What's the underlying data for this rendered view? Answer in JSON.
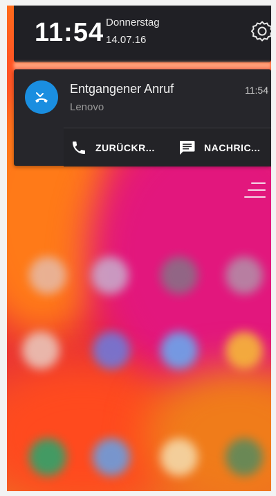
{
  "lock_header": {
    "time": "11:54",
    "day": "Donnerstag",
    "date": "14.07.16",
    "settings_icon": "gear-icon"
  },
  "notification": {
    "icon": "missed-call-icon",
    "title": "Entgangener Anruf",
    "app": "Lenovo",
    "time": "11:54",
    "actions": [
      {
        "label": "ZURÜCKR...",
        "icon": "phone-icon"
      },
      {
        "label": "NACHRIC...",
        "icon": "message-icon"
      }
    ]
  },
  "menu": {
    "icon": "menu-lines-icon"
  },
  "colors": {
    "accent": "#1a8ee0",
    "panel": "#26262b",
    "header": "#202025"
  }
}
